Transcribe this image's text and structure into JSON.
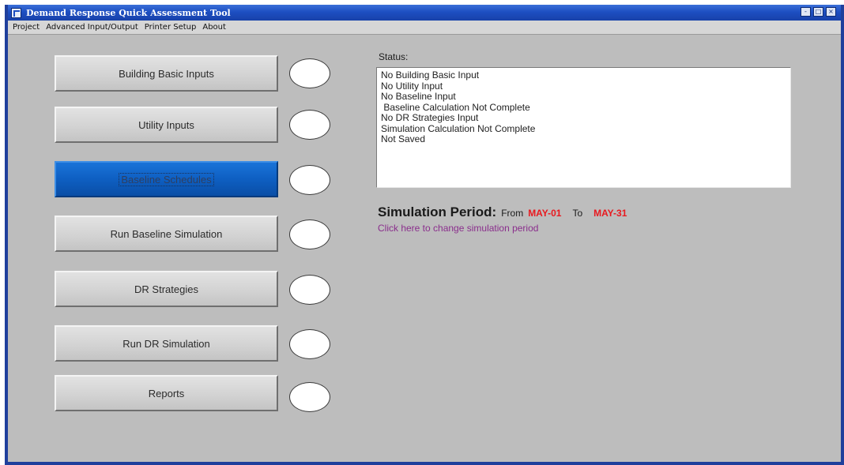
{
  "window": {
    "title": "Demand Response Quick Assessment Tool",
    "controls": [
      "-",
      "□",
      "×"
    ]
  },
  "menu": [
    {
      "label": "Project"
    },
    {
      "label": "Advanced Input/Output"
    },
    {
      "label": "Printer Setup"
    },
    {
      "label": "About"
    }
  ],
  "steps": [
    {
      "label": "Building Basic Inputs"
    },
    {
      "label": "Utility Inputs"
    },
    {
      "label": "Baseline Schedules",
      "active": true
    },
    {
      "label": "Run Baseline Simulation"
    },
    {
      "label": "DR Strategies"
    },
    {
      "label": "Run DR  Simulation"
    },
    {
      "label": "Reports"
    }
  ],
  "status": {
    "label": "Status:",
    "lines": [
      "No Building Basic Input",
      "No Utility Input",
      "No Baseline Input",
      " Baseline Calculation Not Complete",
      "No DR Strategies Input",
      "Simulation Calculation Not Complete",
      "Not Saved"
    ]
  },
  "simulation": {
    "title": "Simulation Period:",
    "from_label": "From",
    "from_value": "MAY-01",
    "to_label": "To",
    "to_value": "MAY-31",
    "change_link": "Click here to change simulation period"
  },
  "colors": {
    "window_border": "#1f3f9c",
    "panel_bg": "#bdbdbd",
    "active_button": "#0e5fc2",
    "date_red": "#e8191f",
    "link_purple": "#8a2e8c"
  }
}
